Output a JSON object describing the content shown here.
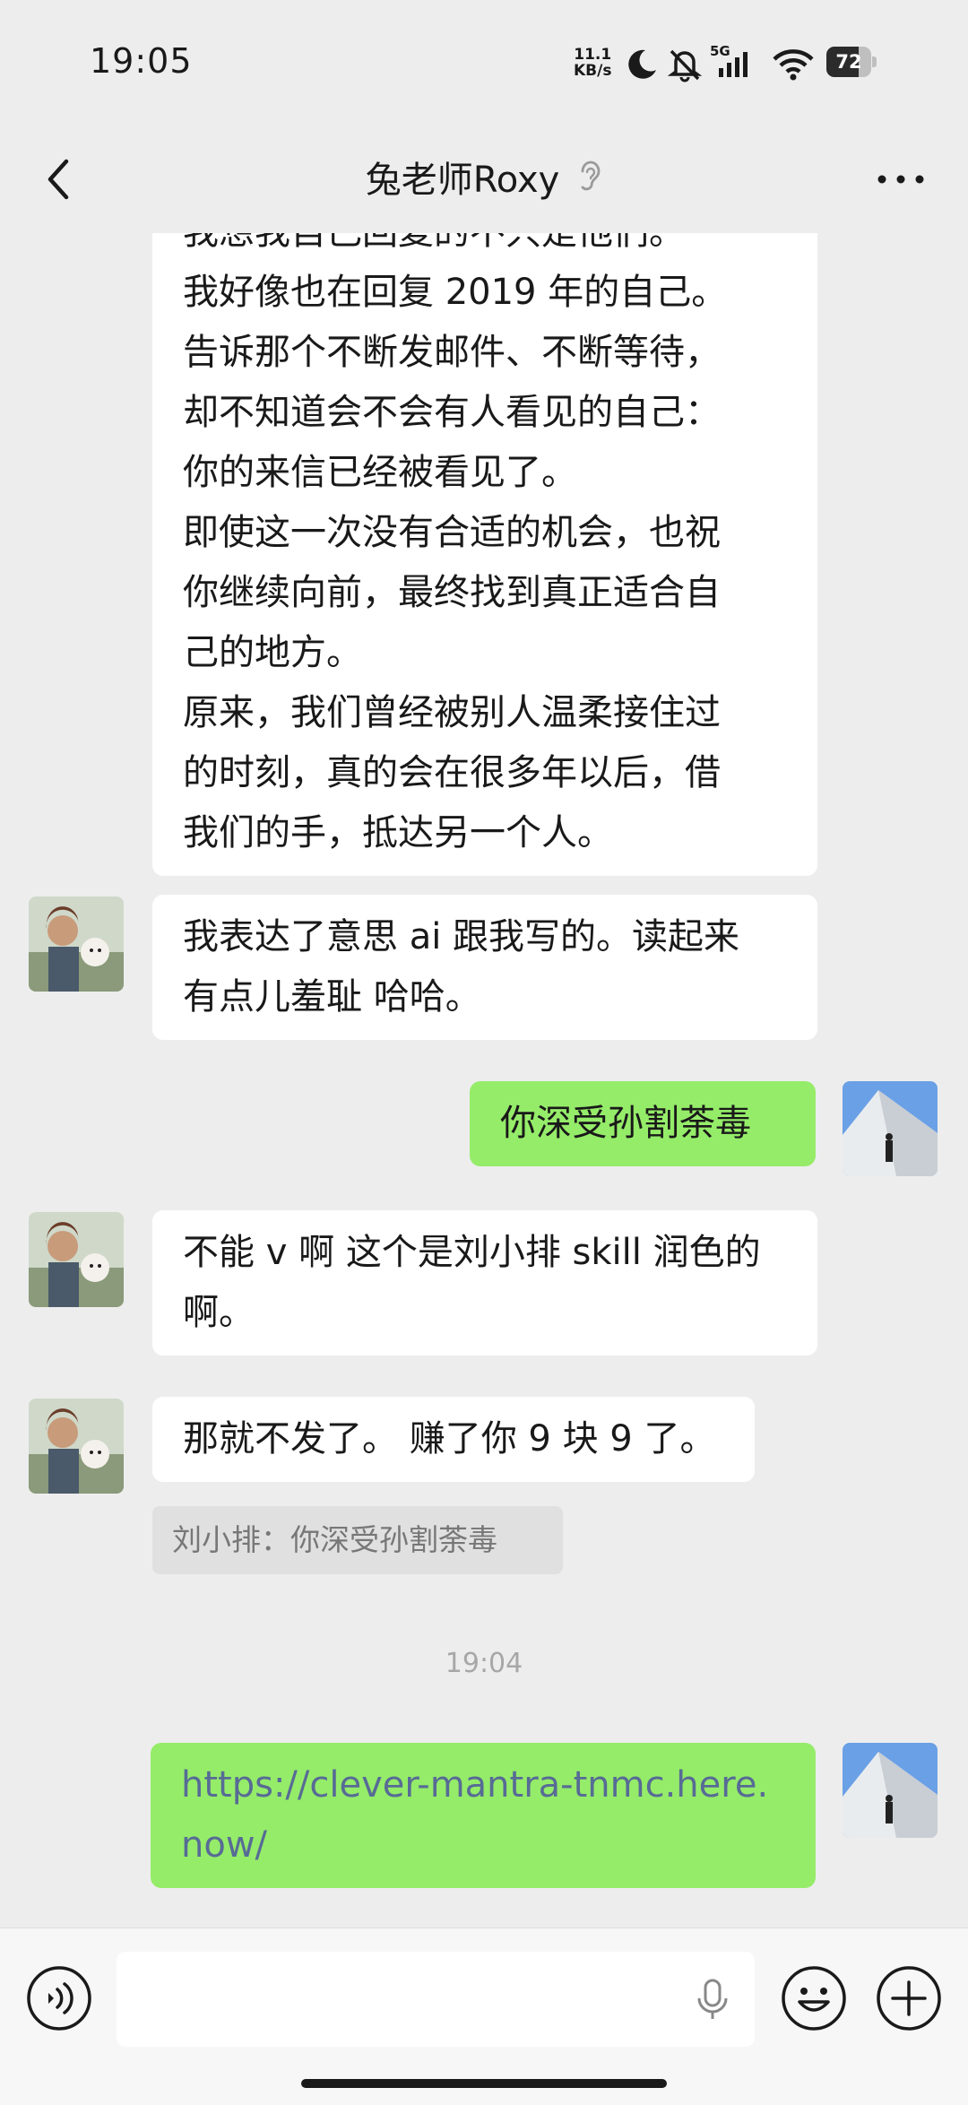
{
  "status_bar": {
    "time": "19:05",
    "net_speed_value": "11.1",
    "net_speed_unit": "KB/s",
    "network": "5G",
    "battery": "72",
    "icons": [
      "moon-icon",
      "bell-muted-icon",
      "signal-icon",
      "wifi-icon",
      "battery-icon"
    ]
  },
  "header": {
    "title": "兔老师Roxy",
    "back_icon": "chevron-left-icon",
    "listen_icon": "ear-icon",
    "more_icon": "more-dots-icon"
  },
  "messages": [
    {
      "side": "in",
      "text": "我想我自己回复的不只是他们。\n我好像也在回复 2019 年的自己。\n告诉那个不断发邮件、不断等待，\n却不知道会不会有人看见的自己：\n你的来信已经被看见了。\n即使这一次没有合适的机会，也祝\n你继续向前，最终找到真正适合自\n己的地方。\n原来，我们曾经被别人温柔接住过\n的时刻，真的会在很多年以后，借\n我们的手，抵达另一个人。"
    },
    {
      "side": "in",
      "text": "我表达了意思 ai 跟我写的。读起来\n有点儿羞耻 哈哈。"
    },
    {
      "side": "out",
      "text": "你深受孙割荼毒"
    },
    {
      "side": "in",
      "text": "不能 v 啊 这个是刘小排 skill 润色的\n啊。"
    },
    {
      "side": "in",
      "text": "那就不发了。 赚了你 9 块 9 了。"
    },
    {
      "side": "quote",
      "text": "刘小排：你深受孙割荼毒"
    },
    {
      "side": "time",
      "text": "19:04"
    },
    {
      "side": "out",
      "text": "https://clever-mantra-tnmc.here.\nnow/"
    }
  ],
  "input_bar": {
    "voice_icon": "voice-icon",
    "mic_icon": "mic-icon",
    "emoji_icon": "emoji-icon",
    "plus_icon": "plus-icon"
  },
  "colors": {
    "background": "#ededed",
    "incoming_bubble": "#ffffff",
    "outgoing_bubble": "#95ec69",
    "link": "#576b95"
  }
}
